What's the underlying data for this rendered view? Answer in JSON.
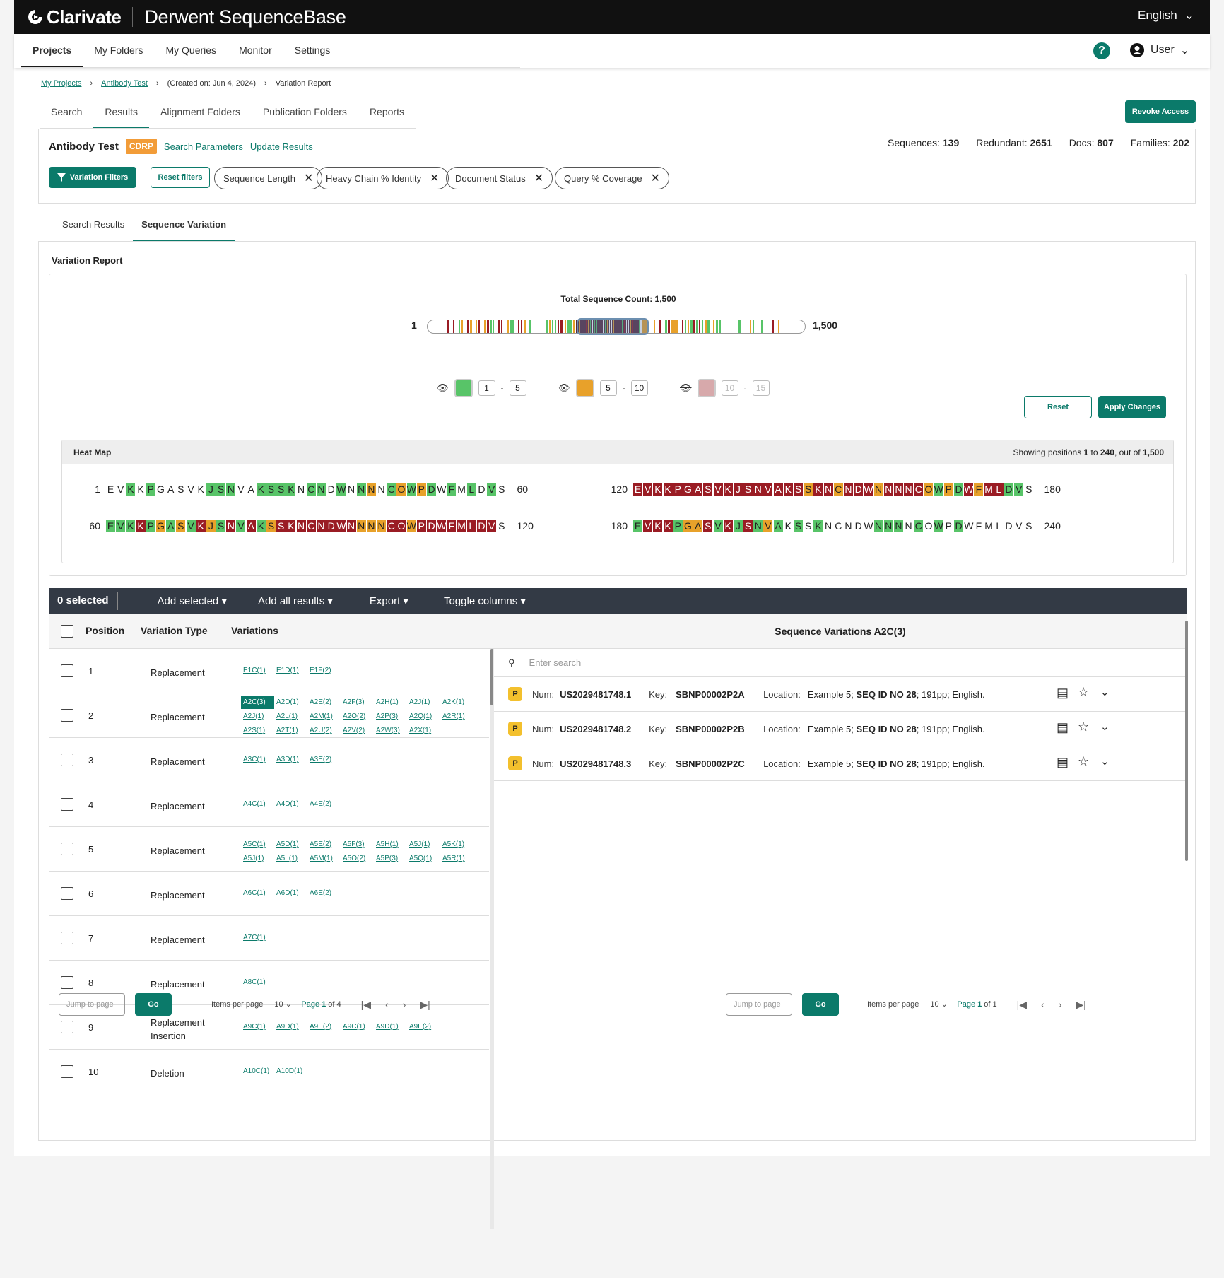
{
  "topbar": {
    "brand": "Clarivate",
    "product": "Derwent SequenceBase",
    "language": "English"
  },
  "mainnav": {
    "items": [
      "Projects",
      "My Folders",
      "My Queries",
      "Monitor",
      "Settings"
    ],
    "help": "?",
    "user": "User"
  },
  "breadcrumb": {
    "items": [
      "My Projects",
      "Antibody Test",
      "(Created on: Jun 4, 2024)",
      "Variation Report"
    ]
  },
  "project_tabs": [
    "Search",
    "Results",
    "Alignment Folders",
    "Publication Folders",
    "Reports"
  ],
  "revoke_label": "Revoke Access",
  "project": {
    "name": "Antibody Test",
    "badge": "CDRP",
    "search_params": "Search Parameters",
    "update_results": "Update Results",
    "stats": {
      "sequences_label": "Sequences:",
      "sequences": "139",
      "redundant_label": "Redundant:",
      "redundant": "2651",
      "docs_label": "Docs:",
      "docs": "807",
      "families_label": "Families:",
      "families": "202"
    },
    "variation_filters": "Variation Filters",
    "reset_filters": "Reset filters",
    "chips": [
      "Sequence Length",
      "Heavy Chain % Identity",
      "Document Status",
      "Query % Coverage"
    ]
  },
  "result_tabs": [
    "Search Results",
    "Sequence Variation"
  ],
  "variation_report": {
    "title": "Variation Report",
    "total_count": "Total Sequence Count: 1,500",
    "bar_start": "1",
    "bar_end": "1,500",
    "legend": [
      {
        "color": "#58c468",
        "from": "1",
        "to": "5",
        "visible": true
      },
      {
        "color": "#e8a12a",
        "from": "5",
        "to": "10",
        "visible": true
      },
      {
        "color": "#d7a9ab",
        "from": "10",
        "to": "15",
        "visible": false
      }
    ],
    "reset": "Reset",
    "apply": "Apply Changes"
  },
  "heatmap": {
    "title": "Heat Map",
    "showing_prefix": "Showing positions ",
    "from": "1",
    "mid": " to ",
    "to": "240",
    "suffix": ", out of ",
    "total": "1,500",
    "lines": [
      {
        "start": "1",
        "end": "60",
        "seq": "EVKKPGASVKJSNVAKSSKNCNDWNNNNCOWPDWFMLDVS",
        "cls": "wwgwgwwwwwgggwwggggwggwgwgowgogogwgwgwg"
      },
      {
        "start": "120",
        "end": "180",
        "seq": "EVKKPGASVKJSNVAKSSKNCNDWNNNNCOWPDWFMLDVS",
        "cls": "rrrrrrrrrrrrrrrrrorrorrrorrrrogogrorrgg"
      },
      {
        "start": "60",
        "end": "120",
        "seq": "EVKKPGASVKJSNVAKSSKNCNDWNNNNCOWPDWFMLDVS",
        "cls": "gggrgogogrogrgrgorrrrrrrrooorrorrrrrrrr"
      },
      {
        "start": "180",
        "end": "240",
        "seq": "EVKKPGASVKJSNVAKSSKNCNDWNNNNCOWPDWFMLDVS",
        "cls": "grrrgoorgrgrgogwgwgwwwwwgggwgwgwgwwwwww"
      }
    ]
  },
  "toolbar": {
    "selected": "0 selected",
    "add_selected": "Add selected",
    "add_all": "Add all results",
    "export": "Export",
    "toggle": "Toggle columns"
  },
  "table": {
    "headers": {
      "position": "Position",
      "type": "Variation Type",
      "variations": "Variations",
      "right_title": "Sequence Variations A2C(3)"
    },
    "rows": [
      {
        "pos": "1",
        "type": "Replacement",
        "vars": [
          "E1C(1)",
          "E1D(1)",
          "E1F(2)"
        ]
      },
      {
        "pos": "2",
        "type": "Replacement",
        "vars": [
          "A2C(3)",
          "A2D(1)",
          "A2E(2)",
          "A2F(3)",
          "A2H(1)",
          "A2J(1)",
          "A2K(1)",
          "A2J(1)",
          "A2L(1)",
          "A2M(1)",
          "A2O(2)",
          "A2P(3)",
          "A2Q(1)",
          "A2R(1)",
          "A2S(1)",
          "A2T(1)",
          "A2U(2)",
          "A2V(2)",
          "A2W(3)",
          "A2X(1)"
        ]
      },
      {
        "pos": "3",
        "type": "Replacement",
        "vars": [
          "A3C(1)",
          "A3D(1)",
          "A3E(2)"
        ]
      },
      {
        "pos": "4",
        "type": "Replacement",
        "vars": [
          "A4C(1)",
          "A4D(1)",
          "A4E(2)"
        ]
      },
      {
        "pos": "5",
        "type": "Replacement",
        "vars": [
          "A5C(1)",
          "A5D(1)",
          "A5E(2)",
          "A5F(3)",
          "A5H(1)",
          "A5J(1)",
          "A5K(1)",
          "A5J(1)",
          "A5L(1)",
          "A5M(1)",
          "A5O(2)",
          "A5P(3)",
          "A5Q(1)",
          "A5R(1)"
        ]
      },
      {
        "pos": "6",
        "type": "Replacement",
        "vars": [
          "A6C(1)",
          "A6D(1)",
          "A6E(2)"
        ]
      },
      {
        "pos": "7",
        "type": "Replacement",
        "vars": [
          "A7C(1)"
        ]
      },
      {
        "pos": "8",
        "type": "Replacement",
        "vars": [
          "A8C(1)"
        ]
      },
      {
        "pos": "9",
        "type": "Replacement Insertion",
        "vars": [
          "A9C(1)",
          "A9D(1)",
          "A9E(2)",
          "A9C(1)",
          "A9D(1)",
          "A9E(2)"
        ]
      },
      {
        "pos": "10",
        "type": "Deletion",
        "vars": [
          "A10C(1)",
          "A10D(1)"
        ]
      }
    ]
  },
  "right_panel": {
    "search_placeholder": "Enter search",
    "rows": [
      {
        "badge": "P",
        "num_label": "Num:",
        "num": "US2029481748.1",
        "key_label": "Key:",
        "key": "SBNP00002P2A",
        "loc_label": "Location:",
        "loc_pre": "Example 5; ",
        "loc_bold": "SEQ ID NO 28",
        "loc_post": "; 191pp; English."
      },
      {
        "badge": "P",
        "num_label": "Num:",
        "num": "US2029481748.2",
        "key_label": "Key:",
        "key": "SBNP00002P2B",
        "loc_label": "Location:",
        "loc_pre": "Example 5; ",
        "loc_bold": "SEQ ID NO 28",
        "loc_post": "; 191pp; English."
      },
      {
        "badge": "P",
        "num_label": "Num:",
        "num": "US2029481748.3",
        "key_label": "Key:",
        "key": "SBNP00002P2C",
        "loc_label": "Location:",
        "loc_pre": "Example 5; ",
        "loc_bold": "SEQ ID NO 28",
        "loc_post": "; 191pp; English."
      }
    ]
  },
  "pager_left": {
    "jump": "Jump to page",
    "go": "Go",
    "ipp": "Items per page",
    "size": "10",
    "page_label": "Page ",
    "page": "1",
    "of": " of 4"
  },
  "pager_right": {
    "jump": "Jump to page",
    "go": "Go",
    "ipp": "Items per page",
    "size": "10",
    "page_label": "Page ",
    "page": "1",
    "of": " of 1"
  },
  "colors": {
    "accent": "#0b7a6a",
    "low": "#58c468",
    "mid": "#e8a12a",
    "high": "#9a1c24"
  }
}
